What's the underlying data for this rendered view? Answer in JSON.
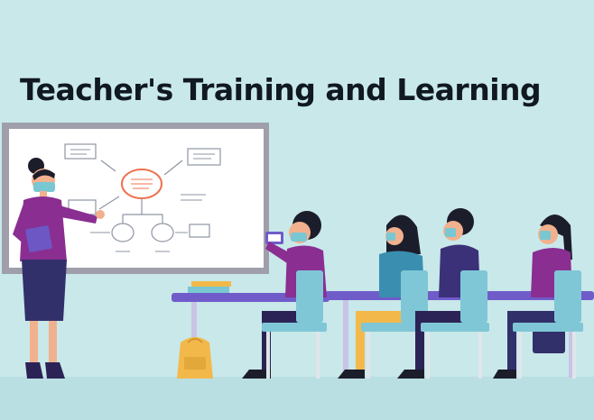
{
  "heading": {
    "title": "Teacher's Training and Learning"
  },
  "colors": {
    "background": "#c9e8ea",
    "board_frame": "#9e9faa",
    "board_surface": "#ffffff",
    "sketch_accent": "#f0714f",
    "shirt_purple": "#8a2e92",
    "skirt_navy": "#31306a",
    "desk_purple": "#6f5cc9",
    "chair_blue": "#7fc7d6",
    "backpack": "#f2b94a",
    "floor": "#b5dcdf"
  },
  "icons": [
    "whiteboard-icon",
    "teacher-figure-icon",
    "student-figure-icon",
    "chair-icon",
    "backpack-icon",
    "book-stack-icon"
  ]
}
